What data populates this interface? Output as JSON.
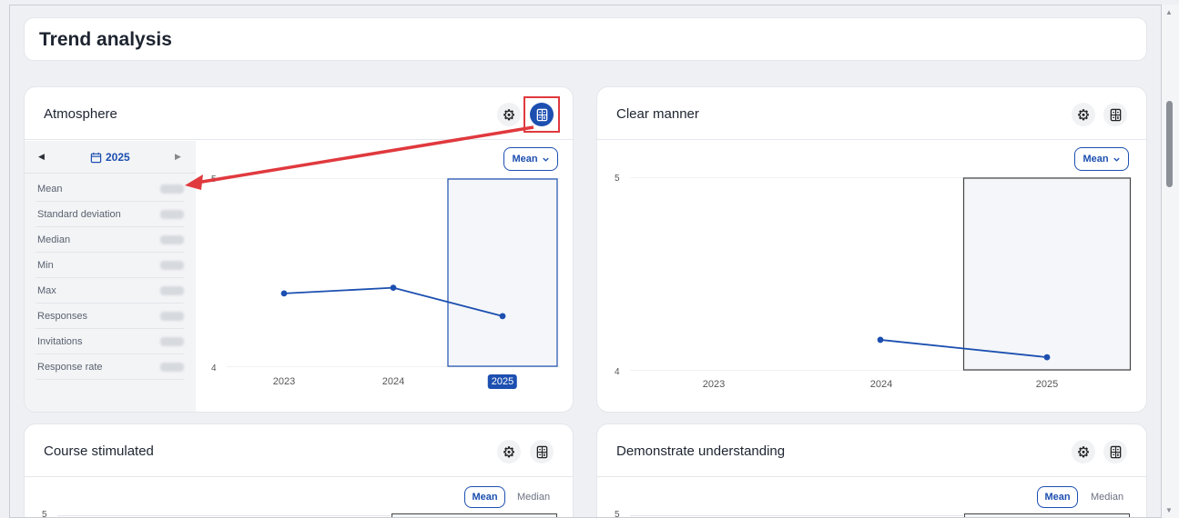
{
  "page": {
    "title": "Trend analysis"
  },
  "cards": [
    {
      "title": "Atmosphere",
      "stats_panel": {
        "year": "2025",
        "rows": [
          "Mean",
          "Standard deviation",
          "Median",
          "Min",
          "Max",
          "Responses",
          "Invitations",
          "Response rate"
        ]
      },
      "measure_select": "Mean",
      "chart_data": {
        "type": "line",
        "x": [
          "2023",
          "2024",
          "2025"
        ],
        "values": [
          4.39,
          4.42,
          4.27
        ],
        "ylim": [
          4,
          5
        ],
        "y_ticks": [
          "5",
          "4"
        ],
        "highlight": "2025"
      }
    },
    {
      "title": "Clear manner",
      "measure_select": "Mean",
      "chart_data": {
        "type": "line",
        "x": [
          "2023",
          "2024",
          "2025"
        ],
        "values": [
          null,
          4.16,
          4.07
        ],
        "ylim": [
          4,
          5
        ],
        "y_ticks": [
          "5",
          "4"
        ],
        "highlight": "2025"
      }
    },
    {
      "title": "Course stimulated",
      "toggle": {
        "active": "Mean",
        "other": "Median"
      },
      "y_top": "5"
    },
    {
      "title": "Demonstrate understanding",
      "toggle": {
        "active": "Mean",
        "other": "Median"
      },
      "y_top": "5"
    }
  ],
  "icons": {
    "settings": "settings-cog-icon",
    "calculator": "calculator-icon",
    "calendar": "calendar-icon",
    "chevron": "chevron-down-icon"
  },
  "colors": {
    "accent": "#1c4fb0",
    "highlight_red": "#e0393e"
  }
}
